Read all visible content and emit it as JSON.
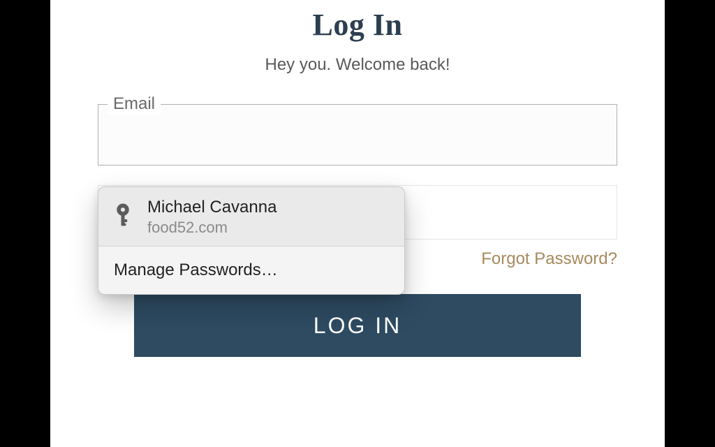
{
  "heading": "Log In",
  "subtitle": "Hey you. Welcome back!",
  "email": {
    "label": "Email",
    "value": ""
  },
  "forgot_label": "Forgot Password?",
  "submit_label": "LOG IN",
  "password_popover": {
    "suggestion": {
      "name": "Michael Cavanna",
      "site": "food52.com"
    },
    "manage_label": "Manage Passwords…"
  }
}
